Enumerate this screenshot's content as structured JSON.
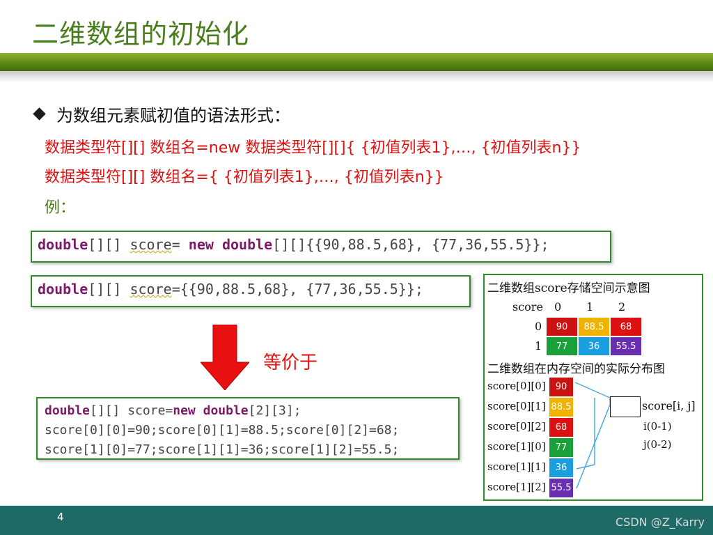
{
  "slide": {
    "title": "二维数组的初始化",
    "bullet": "为数组元素赋初值的语法形式：",
    "syntax_lines": [
      "数据类型符[][] 数组名=new 数据类型符[][]{ {初值列表1},…, {初值列表n}}",
      "数据类型符[][] 数组名={ {初值列表1},…, {初值列表n}}",
      "例："
    ],
    "code1": {
      "type": "double",
      "brackets": "[][] ",
      "var": "score",
      "eq": "= ",
      "new": "new",
      "type2": "double",
      "rest": "[][]{{90,88.5,68}, {77,36,55.5}};"
    },
    "code2": {
      "type": "double",
      "brackets": "[][] ",
      "var": "score",
      "rest": "={{90,88.5,68}, {77,36,55.5}};"
    },
    "equiv_label": "等价于",
    "code3": {
      "line1_type": "double",
      "line1_mid": "[][] score=",
      "line1_new": "new",
      "line1_type2": "double",
      "line1_rest": "[2][3];",
      "line2": "score[0][0]=90;score[0][1]=88.5;score[0][2]=68;",
      "line3": "score[1][0]=77;score[1][1]=36;score[1][2]=55.5;"
    },
    "diagram": {
      "heading1": "二维数组score存储空间示意图",
      "corner_label": "score",
      "col_headers": [
        "0",
        "1",
        "2"
      ],
      "row_headers": [
        "0",
        "1"
      ],
      "grid": [
        [
          "90",
          "88.5",
          "68"
        ],
        [
          "77",
          "36",
          "55.5"
        ]
      ],
      "grid_colors": [
        [
          "#cc1111",
          "#f0b400",
          "#dd1111"
        ],
        [
          "#1aa03a",
          "#1a9ee0",
          "#6a2fb0"
        ]
      ],
      "heading2": "二维数组在内存空间的实际分布图",
      "memory": [
        {
          "label": "score[0][0]",
          "value": "90",
          "color": "#cc1111"
        },
        {
          "label": "score[0][1]",
          "value": "88.5",
          "color": "#f0b400"
        },
        {
          "label": "score[0][2]",
          "value": "68",
          "color": "#dd1111"
        },
        {
          "label": "score[1][0]",
          "value": "77",
          "color": "#1aa03a"
        },
        {
          "label": "score[1][1]",
          "value": "36",
          "color": "#1a9ee0"
        },
        {
          "label": "score[1][2]",
          "value": "55.5",
          "color": "#6a2fb0"
        }
      ],
      "legend_label": "score[i, j]",
      "legend_i": "i(0-1)",
      "legend_j": "j(0-2)"
    },
    "page_number": "4",
    "watermark": "CSDN @Z_Karry"
  }
}
